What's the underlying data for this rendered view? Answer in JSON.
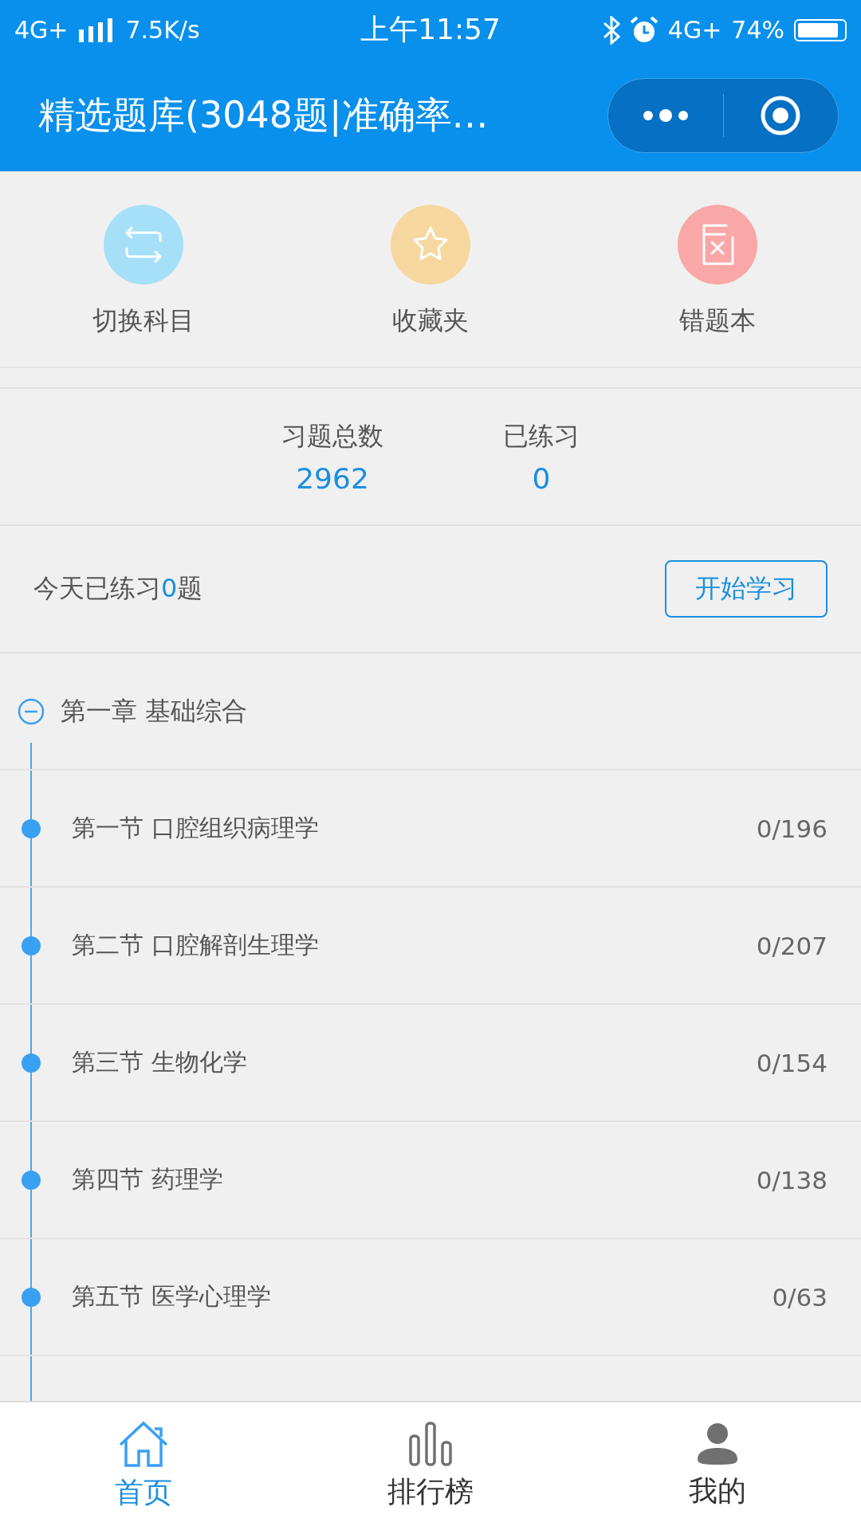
{
  "status_bar": {
    "network": "4G+",
    "speed": "7.5K/s",
    "time": "上午11:57",
    "network_right": "4G+",
    "battery": "74%"
  },
  "header": {
    "title": "精选题库(3048题|准确率…"
  },
  "shortcuts": [
    {
      "label": "切换科目",
      "kind": "switch",
      "color": "#a5e0f8"
    },
    {
      "label": "收藏夹",
      "kind": "star",
      "color": "#f7d7a0"
    },
    {
      "label": "错题本",
      "kind": "wrong",
      "color": "#f9a7a7"
    }
  ],
  "stats": [
    {
      "label": "习题总数",
      "value": "2962"
    },
    {
      "label": "已练习",
      "value": "0"
    }
  ],
  "today": {
    "prefix": "今天已练习",
    "count": "0",
    "suffix": "题",
    "button": "开始学习"
  },
  "chapter": {
    "title": "第一章 基础综合",
    "expanded": true,
    "sections": [
      {
        "title": "第一节 口腔组织病理学",
        "progress": "0/196"
      },
      {
        "title": "第二节 口腔解剖生理学",
        "progress": "0/207"
      },
      {
        "title": "第三节 生物化学",
        "progress": "0/154"
      },
      {
        "title": "第四节 药理学",
        "progress": "0/138"
      },
      {
        "title": "第五节 医学心理学",
        "progress": "0/63"
      }
    ]
  },
  "tabs": [
    {
      "label": "首页",
      "kind": "home",
      "selected": true
    },
    {
      "label": "排行榜",
      "kind": "rank",
      "selected": false
    },
    {
      "label": "我的",
      "kind": "me",
      "selected": false
    }
  ]
}
